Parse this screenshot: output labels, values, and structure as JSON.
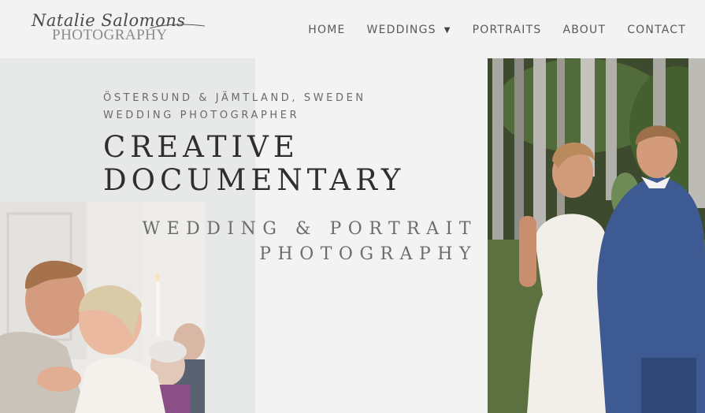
{
  "brand": {
    "script_name": "Natalie Salomons",
    "sub_name": "PHOTOGRAPHY"
  },
  "nav": {
    "items": [
      {
        "label": "HOME"
      },
      {
        "label": "WEDDINGS",
        "has_dropdown": true,
        "icon": "caret-down-icon"
      },
      {
        "label": "PORTRAITS"
      },
      {
        "label": "ABOUT"
      },
      {
        "label": "CONTACT"
      }
    ]
  },
  "hero": {
    "location_line": "ÖSTERSUND & JÄMTLAND, SWEDEN",
    "role_line": "WEDDING PHOTOGRAPHER",
    "headline_line1": "CREATIVE",
    "headline_line2": "DOCUMENTARY",
    "sub_line1": "WEDDING & PORTRAIT",
    "sub_line2": "PHOTOGRAPHY"
  },
  "colors": {
    "page_bg": "#f3f3f3",
    "panel_bg": "#e7e9e8",
    "text_dark": "#2f2f2f",
    "text_muted": "#6a6a6a"
  }
}
